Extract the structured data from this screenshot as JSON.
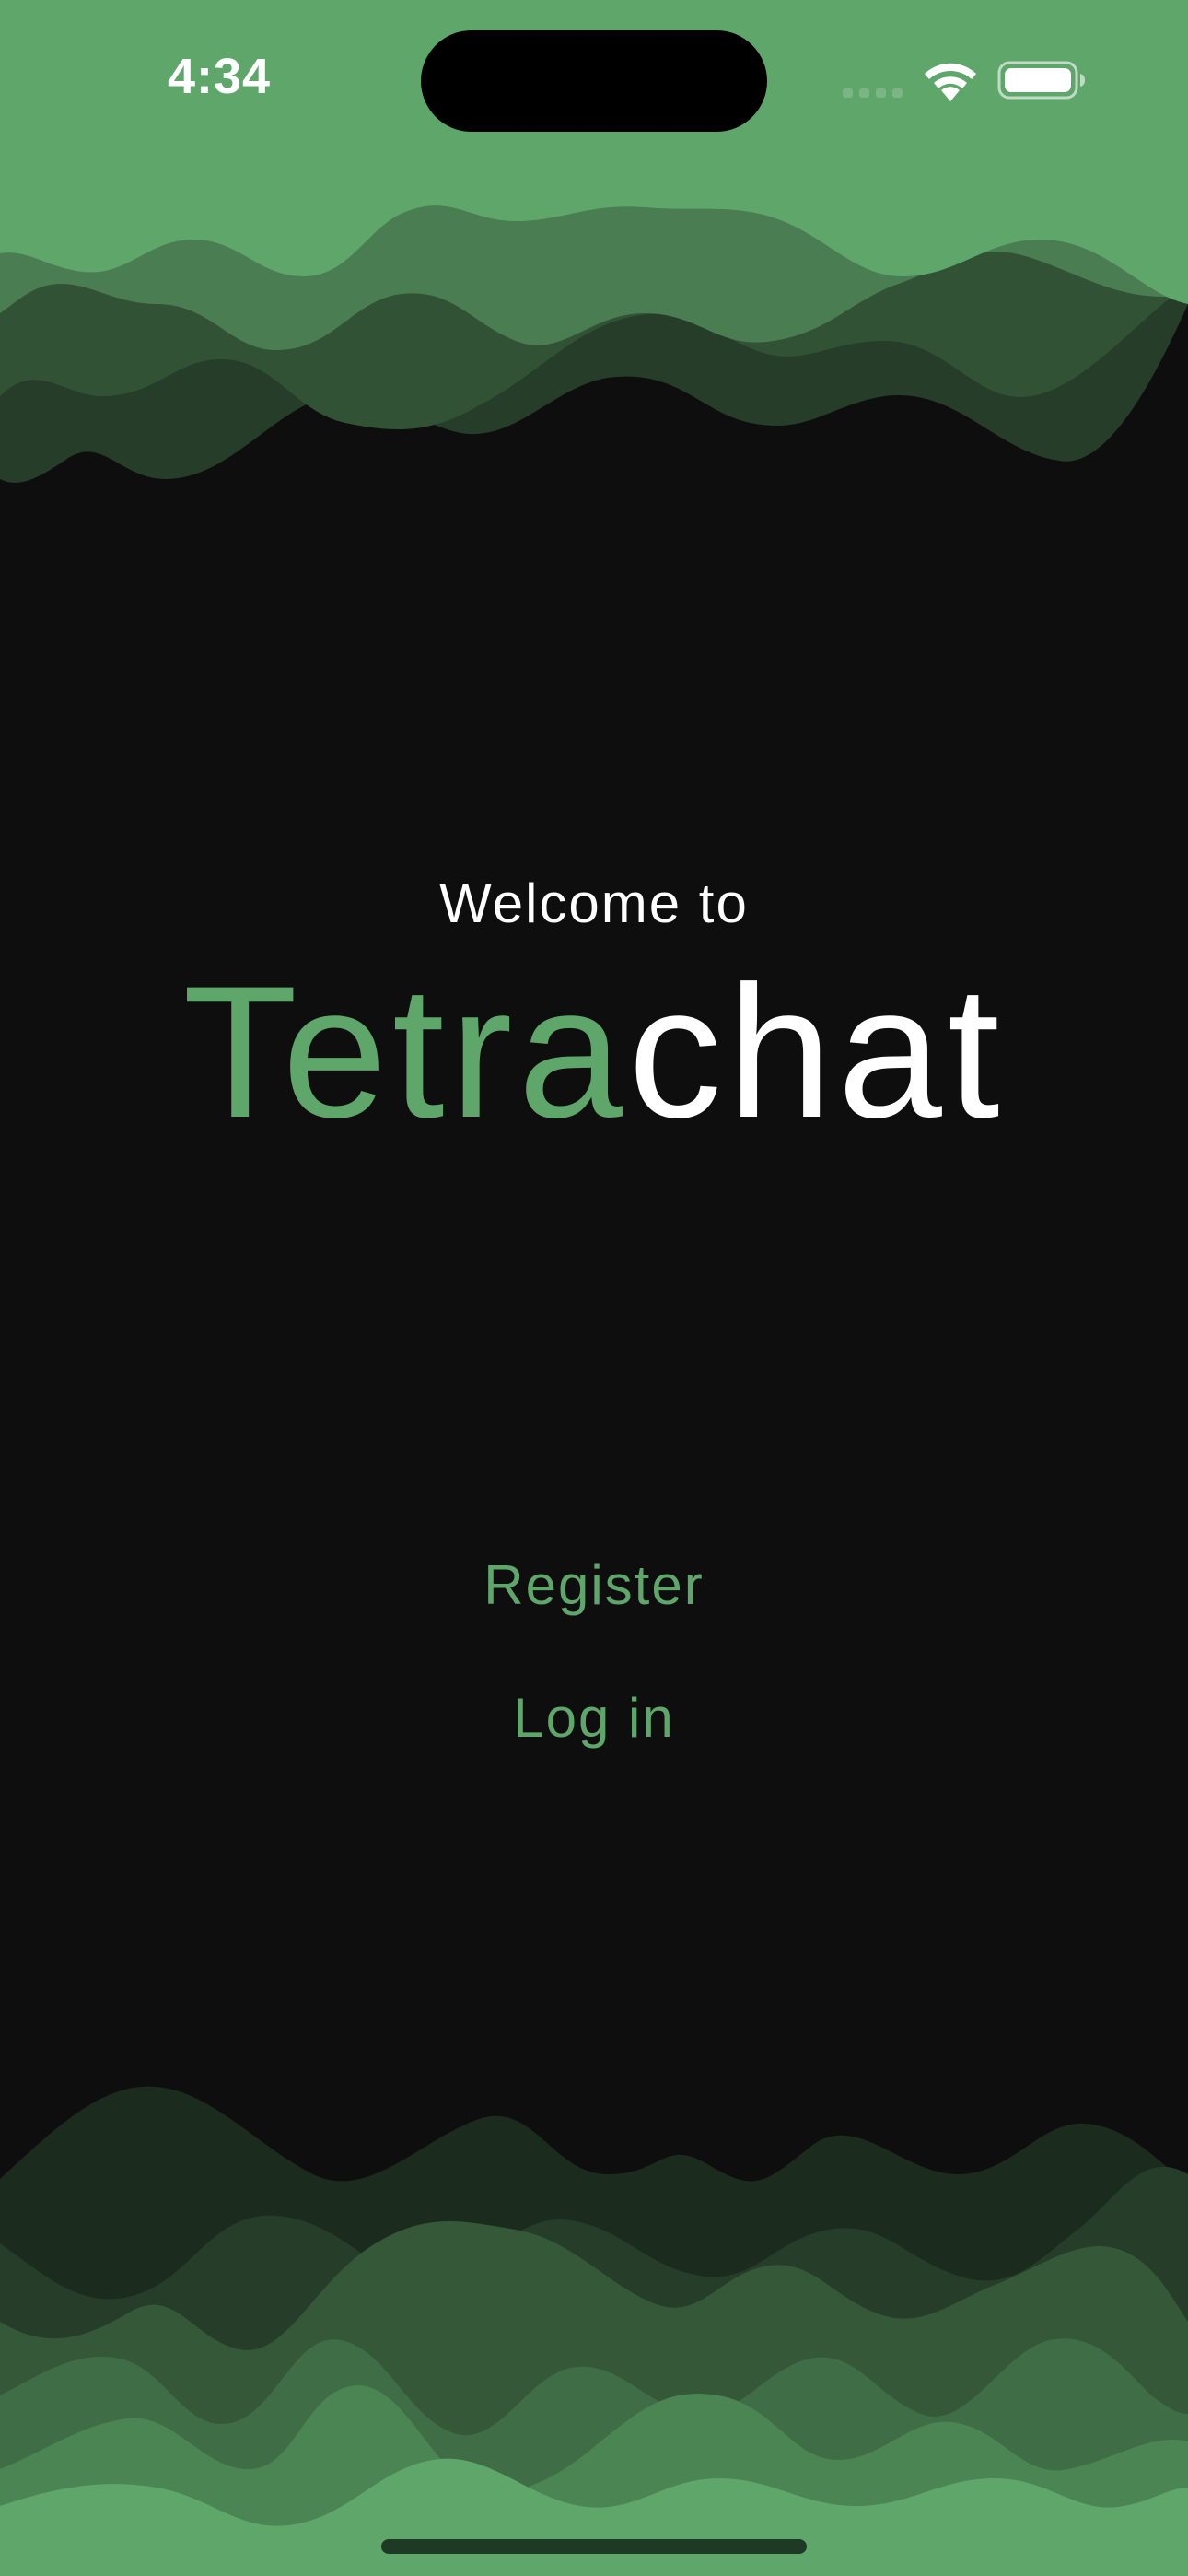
{
  "status_bar": {
    "time": "4:34",
    "signal_icon": "cellular-signal-icon",
    "wifi_icon": "wifi-icon",
    "battery_icon": "battery-icon"
  },
  "welcome": {
    "subtitle": "Welcome to",
    "brand_part1": "Tetra",
    "brand_part2": "chat"
  },
  "actions": {
    "register_label": "Register",
    "login_label": "Log in"
  },
  "colors": {
    "background": "#0e0e0e",
    "accent": "#5fa66b",
    "text": "#ffffff"
  }
}
